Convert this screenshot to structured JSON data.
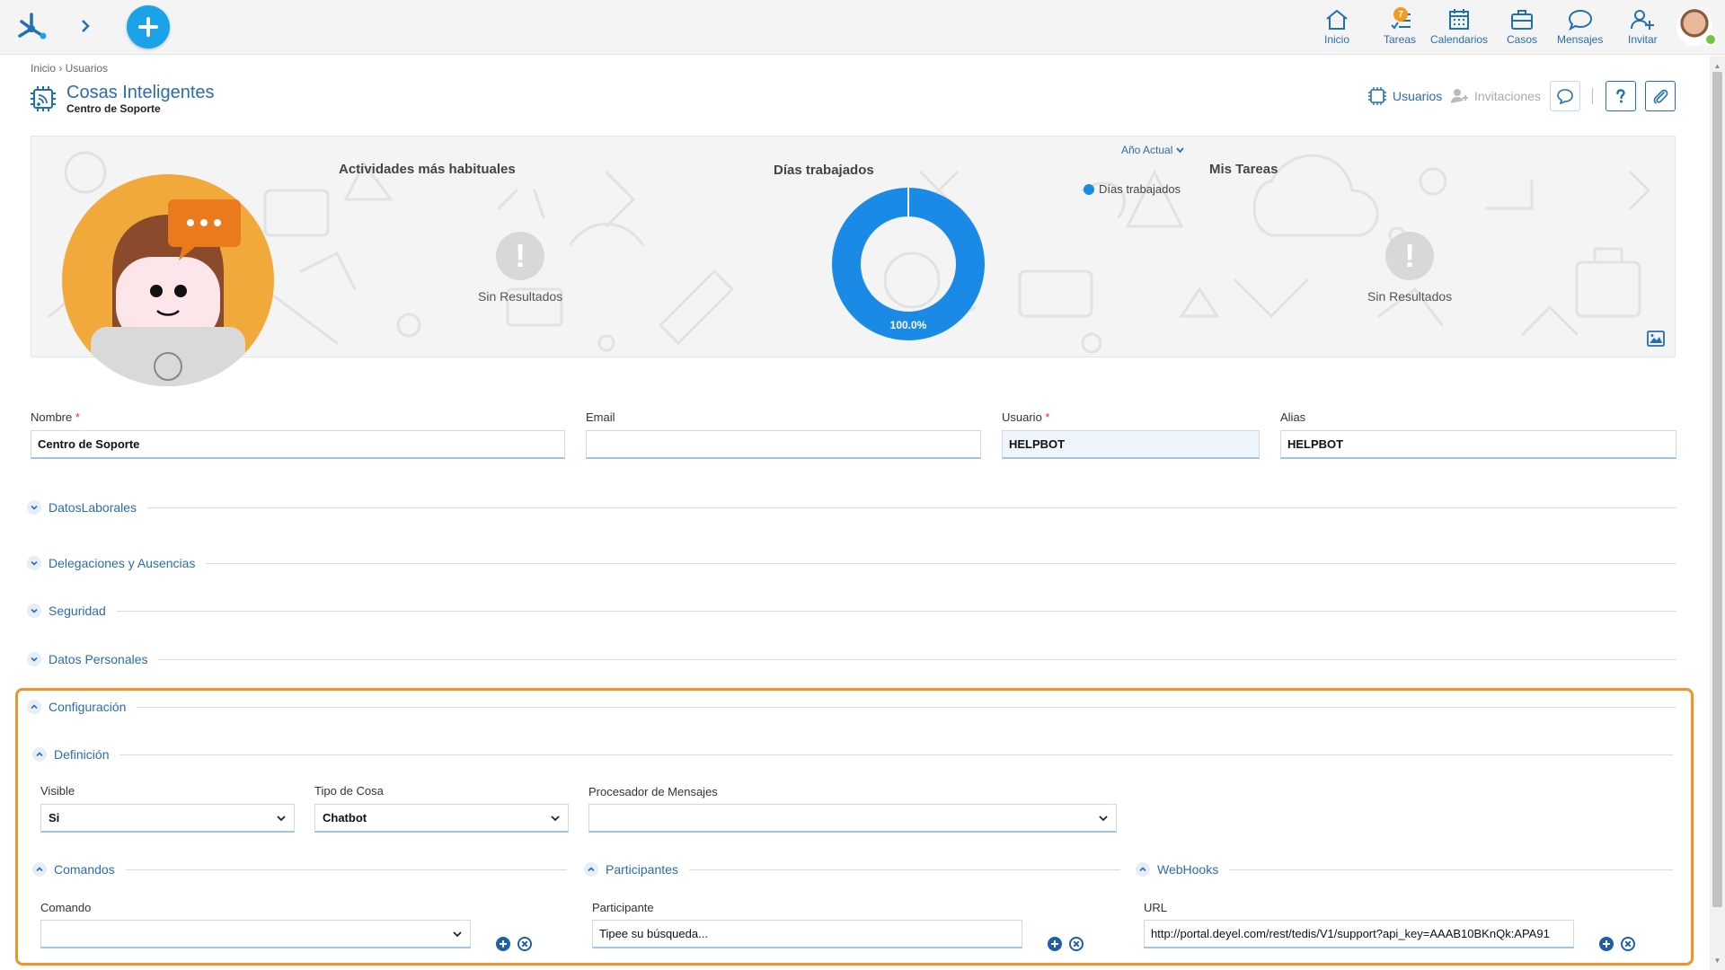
{
  "topbar": {
    "nav": [
      {
        "id": "inicio",
        "label": "Inicio",
        "icon": "home-icon"
      },
      {
        "id": "tareas",
        "label": "Tareas",
        "icon": "tasks-icon",
        "badge": "7"
      },
      {
        "id": "calendarios",
        "label": "Calendarios",
        "icon": "calendar-icon"
      },
      {
        "id": "casos",
        "label": "Casos",
        "icon": "briefcase-icon"
      },
      {
        "id": "mensajes",
        "label": "Mensajes",
        "icon": "chat-icon"
      },
      {
        "id": "invitar",
        "label": "Invitar",
        "icon": "add-user-icon"
      }
    ]
  },
  "header": {
    "breadcrumb": "Inicio › Usuarios",
    "title": "Cosas Inteligentes",
    "subtitle": "Centro de Soporte",
    "links": {
      "usuarios": "Usuarios",
      "invitaciones": "Invitaciones"
    }
  },
  "banner": {
    "actividades_title": "Actividades más habituales",
    "actividades_empty": "Sin Resultados",
    "dias_title": "Días trabajados",
    "year_selector": "Año Actual",
    "legend_label": "Días trabajados",
    "mis_tareas_title": "Mis Tareas",
    "mis_tareas_empty": "Sin Resultados",
    "colors": {
      "donut": "#1a8ae6"
    }
  },
  "chart_data": {
    "type": "pie",
    "categories": [
      "Días trabajados"
    ],
    "values": [
      100.0
    ],
    "data_label": "100.0%",
    "title": "Días trabajados",
    "legend": "top-right"
  },
  "form": {
    "nombre": {
      "label": "Nombre",
      "value": "Centro de Soporte"
    },
    "email": {
      "label": "Email",
      "value": ""
    },
    "usuario": {
      "label": "Usuario",
      "value": "HELPBOT"
    },
    "alias": {
      "label": "Alias",
      "value": "HELPBOT"
    }
  },
  "sections": {
    "datos_laborales": "DatosLaborales",
    "delegaciones": "Delegaciones y Ausencias",
    "seguridad": "Seguridad",
    "datos_personales": "Datos Personales",
    "configuracion": "Configuración",
    "definicion": "Definición",
    "comandos": "Comandos",
    "participantes": "Participantes",
    "webhooks": "WebHooks"
  },
  "definicion": {
    "visible": {
      "label": "Visible",
      "value": "Si"
    },
    "tipo_cosa": {
      "label": "Tipo de Cosa",
      "value": "Chatbot"
    },
    "procesador": {
      "label": "Procesador de Mensajes",
      "value": ""
    }
  },
  "comandos": {
    "label": "Comando",
    "value": ""
  },
  "participantes": {
    "label": "Participante",
    "placeholder": "Tipee su búsqueda..."
  },
  "webhooks": {
    "label": "URL",
    "value": "http://portal.deyel.com/rest/tedis/V1/support?api_key=AAAB10BKnQk:APA91"
  },
  "accent": "#f0932b",
  "brand": "#2b6cae"
}
